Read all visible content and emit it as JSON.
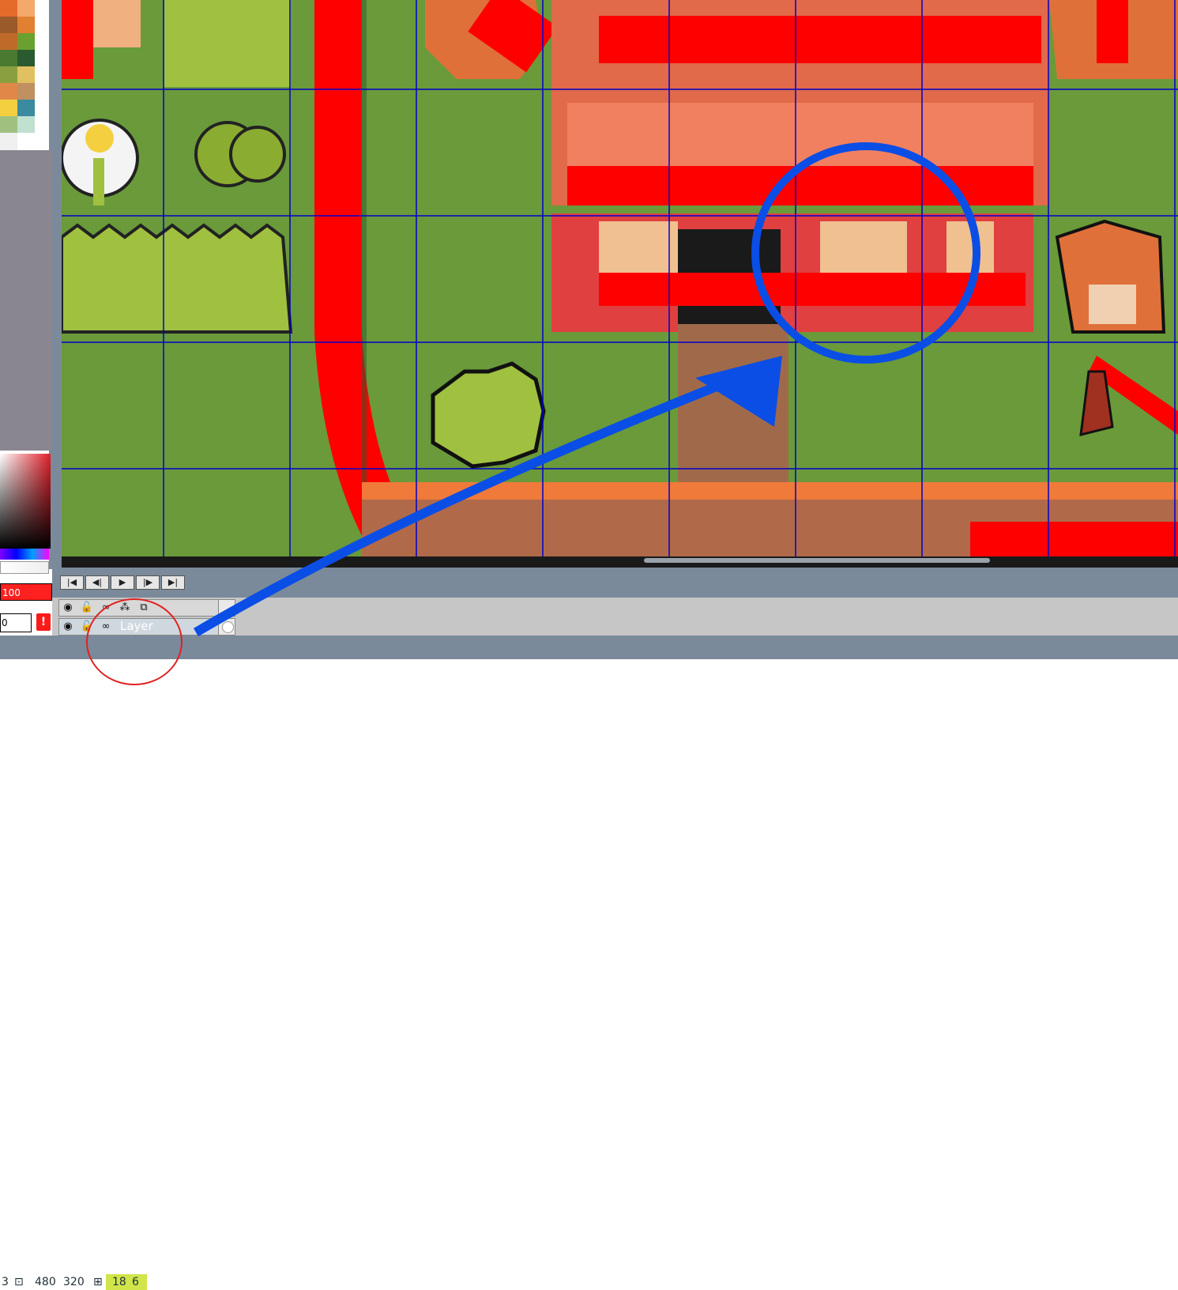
{
  "palette": {
    "colors": [
      "#e56b2a",
      "#f4a86a",
      "#9a5a2a",
      "#e08030",
      "#c06a2a",
      "#6aa030",
      "#4a7a30",
      "#2a5a30",
      "#8aa040",
      "#e0c060",
      "#e08848",
      "#c09060",
      "#f4d040",
      "#3a8aa0",
      "#a0c080",
      "#c0e0d0",
      "#f0f0f0",
      "#ffffff"
    ]
  },
  "color_picker": {
    "opacity_value": "100",
    "number_value": "0",
    "alert_label": "!"
  },
  "toolbar": {
    "first_label": "|◀",
    "prev_label": "◀|",
    "play_label": "▶",
    "next_label": "|▶",
    "last_label": "▶|"
  },
  "layers": {
    "header_icons": [
      "eye-icon",
      "lock-icon",
      "link-icon",
      "blend-icon",
      "copy-icon"
    ],
    "rows": [
      {
        "name": "Layer"
      }
    ]
  },
  "status": {
    "frame": "3",
    "width": "480",
    "height": "320",
    "tile_x": "18",
    "tile_y": "6"
  },
  "colors": {
    "grass": "#6a9a3a",
    "grid_line": "#0000cc",
    "overlay_red": "#ff0000",
    "annotation_blue": "#0a4ee6",
    "annotation_circle": "#e02020",
    "status_highlight": "#c9e12a"
  }
}
